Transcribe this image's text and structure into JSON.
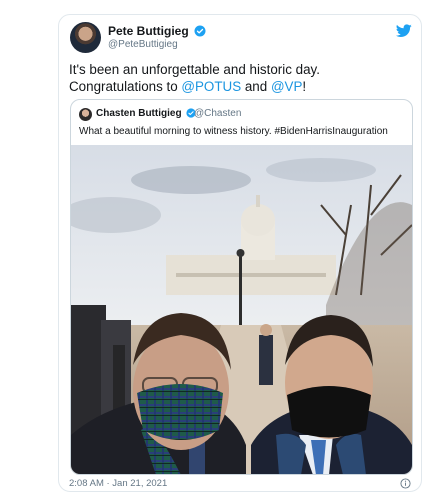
{
  "tweet": {
    "author_name": "Pete Buttigieg",
    "author_handle": "@PeteButtigieg",
    "text_part1": "It's been an unforgettable and historic day. Congratulations to ",
    "mention1": "@POTUS",
    "text_and": " and ",
    "mention2": "@VP",
    "text_end": "!",
    "timestamp": "2:08 AM · Jan 21, 2021"
  },
  "quoted": {
    "author_name": "Chasten Buttigieg",
    "author_handle": "@Chasten",
    "text": "What a beautiful morning to witness history. #BidenHarrisInauguration"
  },
  "colors": {
    "link": "#1b95e0",
    "verified": "#1da1f2",
    "border": "#e1e8ed"
  },
  "icons": [
    "twitter-bird-icon",
    "verified-badge-icon",
    "info-icon"
  ]
}
